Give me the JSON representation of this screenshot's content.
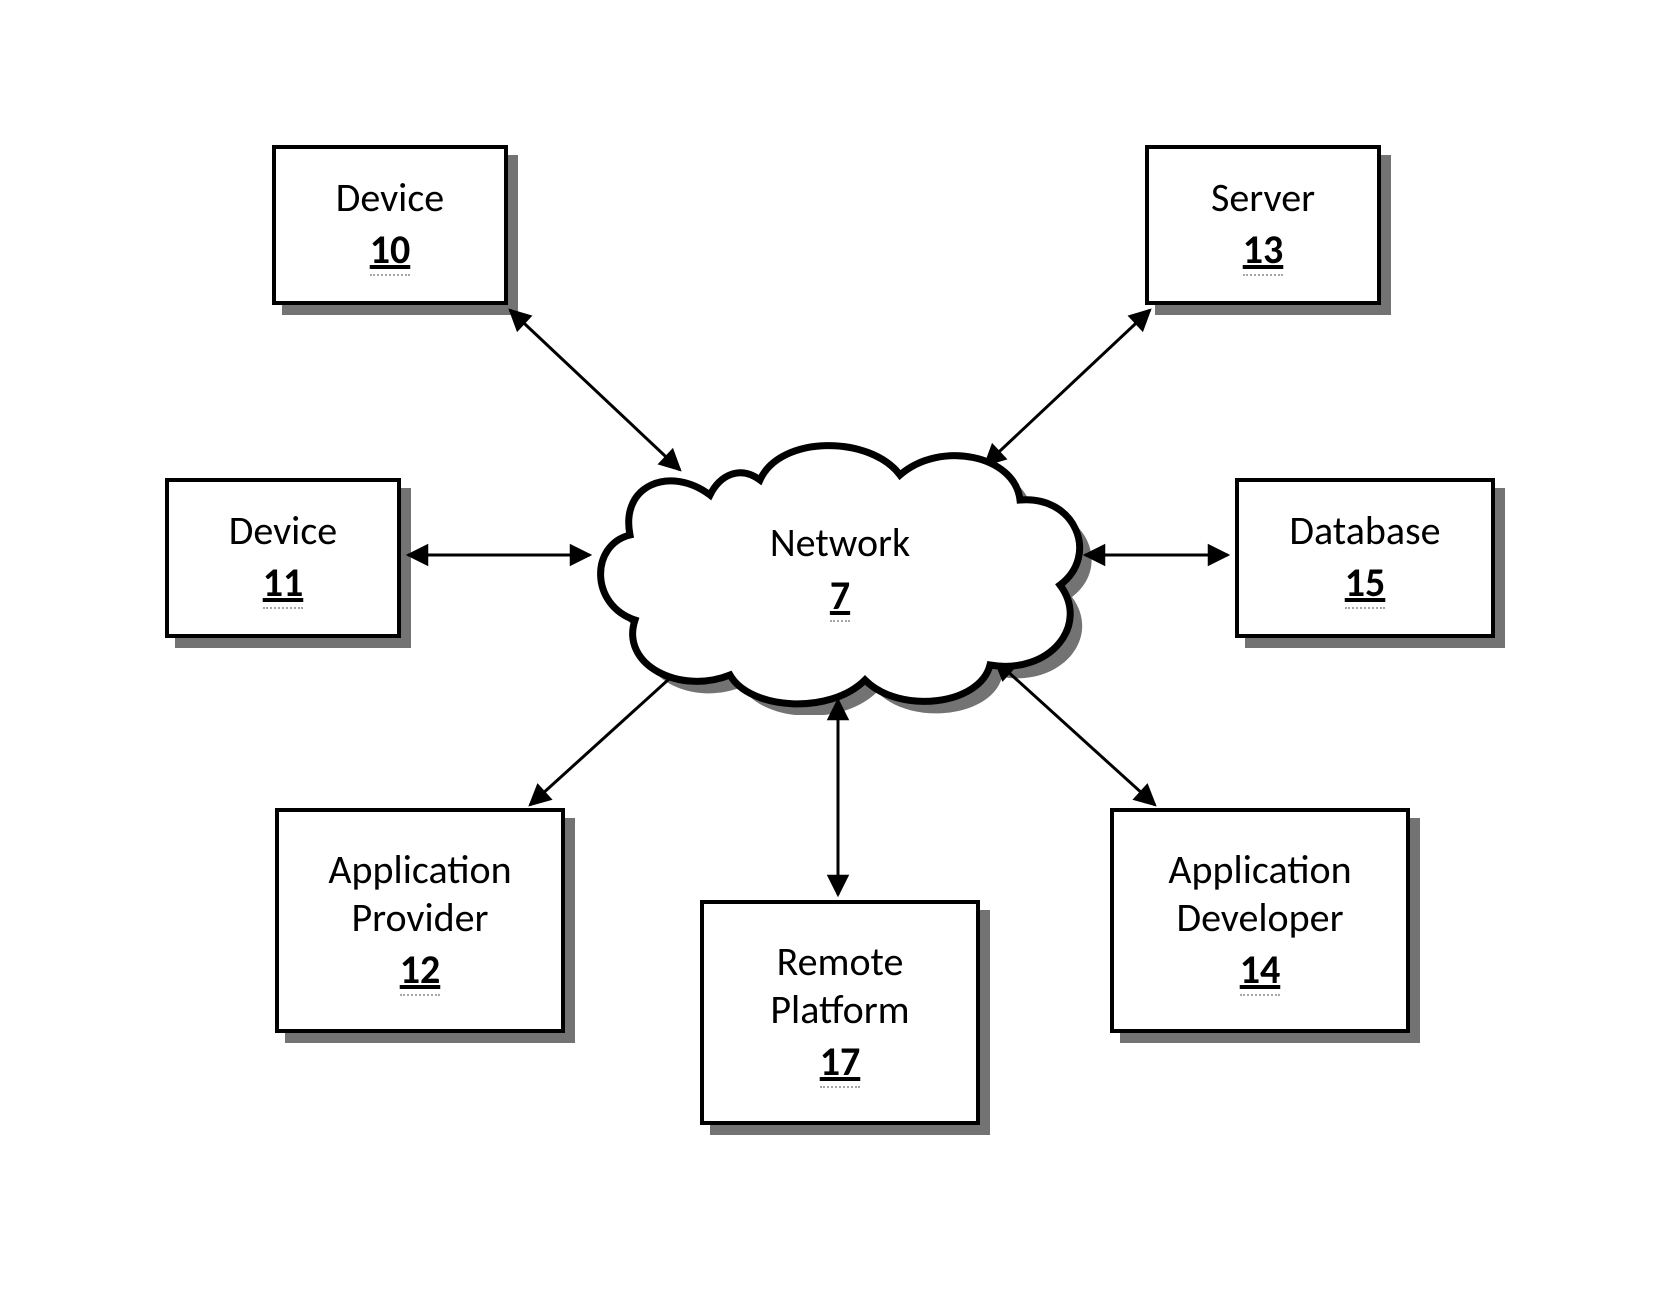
{
  "diagram": {
    "center": {
      "label": "Network",
      "number": "7"
    },
    "nodes": {
      "device10": {
        "label": "Device",
        "number": "10"
      },
      "device11": {
        "label": "Device",
        "number": "11"
      },
      "provider12": {
        "label": "Application\nProvider",
        "number": "12"
      },
      "server13": {
        "label": "Server",
        "number": "13"
      },
      "developer14": {
        "label": "Application\nDeveloper",
        "number": "14"
      },
      "database15": {
        "label": "Database",
        "number": "15"
      },
      "platform17": {
        "label": "Remote\nPlatform",
        "number": "17"
      }
    }
  }
}
